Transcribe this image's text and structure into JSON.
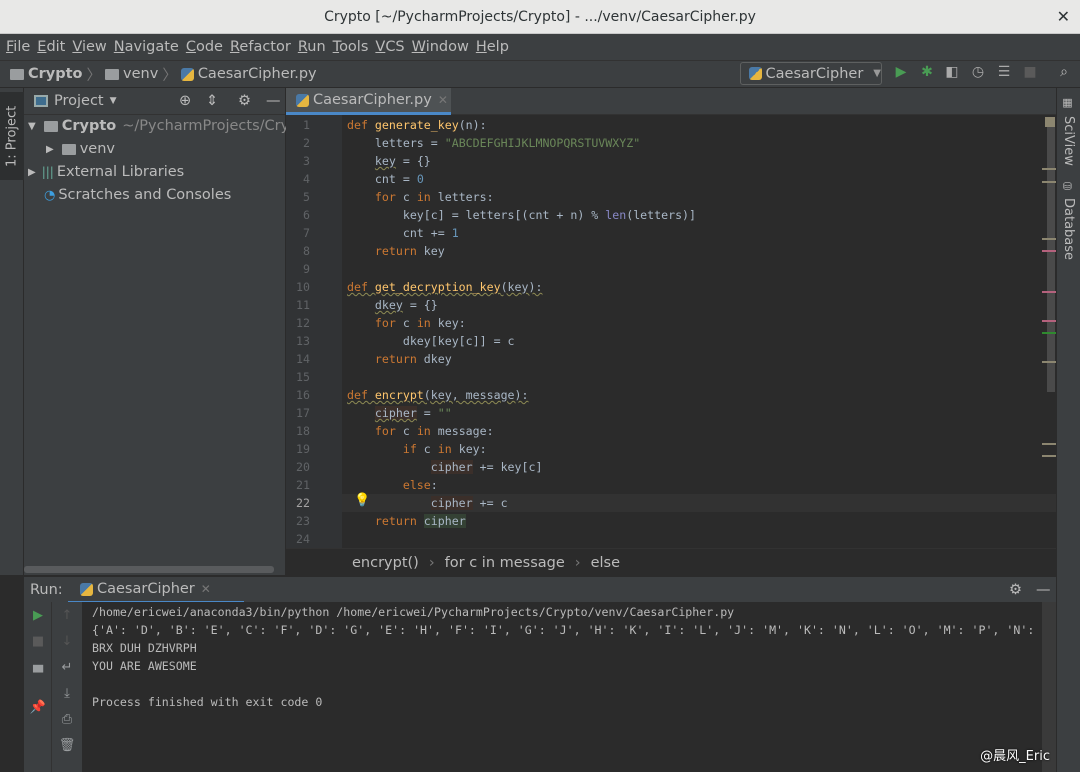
{
  "window": {
    "title": "Crypto [~/PycharmProjects/Crypto] - .../venv/CaesarCipher.py",
    "close": "✕"
  },
  "menu": [
    "File",
    "Edit",
    "View",
    "Navigate",
    "Code",
    "Refactor",
    "Run",
    "Tools",
    "VCS",
    "Window",
    "Help"
  ],
  "nav": {
    "crumbs": [
      "Crypto",
      "venv",
      "CaesarCipher.py"
    ]
  },
  "run_config": {
    "name": "CaesarCipher"
  },
  "tool_windows": {
    "left": "1: Project",
    "right": [
      "SciView",
      "Database"
    ]
  },
  "project": {
    "header": "Project",
    "root": {
      "name": "Crypto",
      "path": "~/PycharmProjects/Crypto"
    },
    "items": [
      "venv",
      "External Libraries",
      "Scratches and Consoles"
    ]
  },
  "editor": {
    "tab": "CaesarCipher.py",
    "current_line": 22,
    "lines": [
      [
        [
          "def ",
          "kw"
        ],
        [
          "generate_key",
          "fn"
        ],
        [
          "(n):",
          ""
        ]
      ],
      [
        [
          "    letters = ",
          ""
        ],
        [
          "\"ABCDEFGHIJKLMNOPQRSTUVWXYZ\"",
          "st"
        ]
      ],
      [
        [
          "    ",
          ""
        ],
        [
          "key",
          "wv"
        ],
        [
          " = {}",
          ""
        ]
      ],
      [
        [
          "    cnt = ",
          ""
        ],
        [
          "0",
          "nm"
        ]
      ],
      [
        [
          "    ",
          ""
        ],
        [
          "for ",
          "kw"
        ],
        [
          "c ",
          ""
        ],
        [
          "in ",
          "kw"
        ],
        [
          "letters:",
          ""
        ]
      ],
      [
        [
          "        key[c] = letters[(cnt + n) % ",
          ""
        ],
        [
          "len",
          "bi"
        ],
        [
          "(letters)]",
          ""
        ]
      ],
      [
        [
          "        cnt += ",
          ""
        ],
        [
          "1",
          "nm"
        ]
      ],
      [
        [
          "    ",
          ""
        ],
        [
          "return ",
          "kw"
        ],
        [
          "key",
          ""
        ]
      ],
      [],
      [
        [
          "def ",
          "kw wv"
        ],
        [
          "get_decryption_key",
          "fn wv"
        ],
        [
          "(key):",
          "wv"
        ]
      ],
      [
        [
          "    ",
          ""
        ],
        [
          "dkey",
          "wv"
        ],
        [
          " = {}",
          ""
        ]
      ],
      [
        [
          "    ",
          ""
        ],
        [
          "for ",
          "kw"
        ],
        [
          "c ",
          ""
        ],
        [
          "in ",
          "kw"
        ],
        [
          "key:",
          ""
        ]
      ],
      [
        [
          "        dkey[key[c]] = c",
          ""
        ]
      ],
      [
        [
          "    ",
          ""
        ],
        [
          "return ",
          "kw"
        ],
        [
          "dkey",
          ""
        ]
      ],
      [],
      [
        [
          "def ",
          "kw wv"
        ],
        [
          "encrypt",
          "fn wv"
        ],
        [
          "(key, message):",
          "wv"
        ]
      ],
      [
        [
          "    ",
          ""
        ],
        [
          "cipher",
          "wv hr"
        ],
        [
          " = ",
          ""
        ],
        [
          "\"\"",
          "st"
        ]
      ],
      [
        [
          "    ",
          ""
        ],
        [
          "for ",
          "kw"
        ],
        [
          "c ",
          ""
        ],
        [
          "in ",
          "kw"
        ],
        [
          "message:",
          ""
        ]
      ],
      [
        [
          "        ",
          ""
        ],
        [
          "if ",
          "kw"
        ],
        [
          "c ",
          ""
        ],
        [
          "in ",
          "kw"
        ],
        [
          "key:",
          ""
        ]
      ],
      [
        [
          "            ",
          ""
        ],
        [
          "cipher",
          "hr"
        ],
        [
          " += key[c]",
          ""
        ]
      ],
      [
        [
          "        ",
          ""
        ],
        [
          "else",
          "kw"
        ],
        [
          ":",
          ""
        ]
      ],
      [
        [
          "            ",
          ""
        ],
        [
          "cipher",
          "hr"
        ],
        [
          " += c",
          ""
        ]
      ],
      [
        [
          "    ",
          ""
        ],
        [
          "return ",
          "kw"
        ],
        [
          "cipher",
          "hl"
        ]
      ],
      []
    ]
  },
  "breadcrumbs": [
    "encrypt()",
    "for c in message",
    "else"
  ],
  "run": {
    "label": "Run:",
    "tab": "CaesarCipher",
    "output": [
      "/home/ericwei/anaconda3/bin/python /home/ericwei/PycharmProjects/Crypto/venv/CaesarCipher.py",
      "{'A': 'D', 'B': 'E', 'C': 'F', 'D': 'G', 'E': 'H', 'F': 'I', 'G': 'J', 'H': 'K', 'I': 'L', 'J': 'M', 'K': 'N', 'L': 'O', 'M': 'P', 'N': 'Q",
      "BRX DUH DZHVRPH",
      "YOU ARE AWESOME",
      "",
      "Process finished with exit code 0"
    ]
  },
  "watermark": "@晨风_Eric",
  "colors": {
    "accent": "#4a88c7",
    "run_green": "#499c54",
    "keyword": "#cc7832",
    "function": "#ffc66d",
    "string": "#6a8759",
    "number": "#6897bb"
  }
}
